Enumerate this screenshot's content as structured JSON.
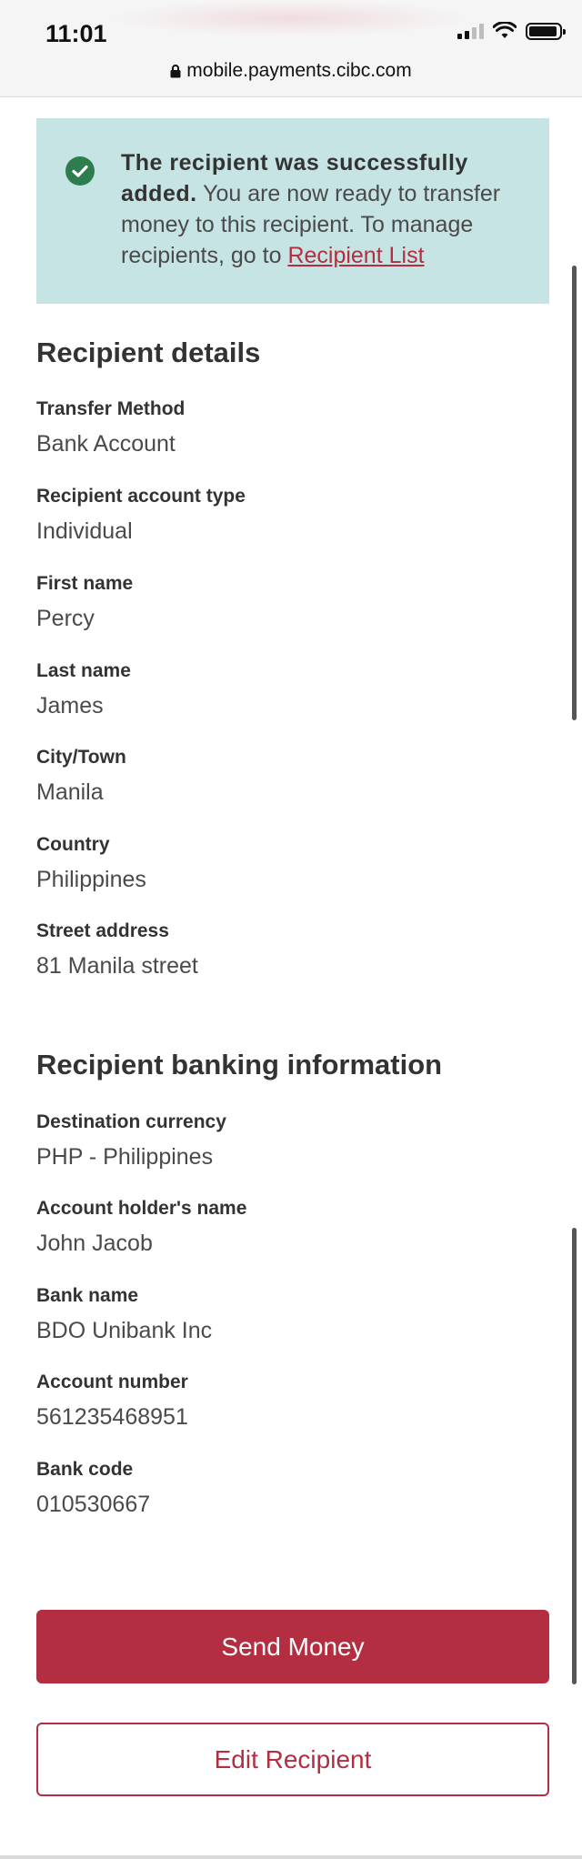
{
  "status_bar": {
    "time": "11:01"
  },
  "browser": {
    "url": "mobile.payments.cibc.com"
  },
  "banner": {
    "title": "The recipient was successfully added.",
    "message": " You are now ready to transfer money to this recipient. To manage recipients, go to ",
    "link_label": "Recipient List"
  },
  "recipient_details": {
    "title": "Recipient details",
    "fields": [
      {
        "label": "Transfer Method",
        "value": "Bank Account"
      },
      {
        "label": "Recipient account type",
        "value": "Individual"
      },
      {
        "label": "First name",
        "value": "Percy"
      },
      {
        "label": "Last name",
        "value": "James"
      },
      {
        "label": "City/Town",
        "value": "Manila"
      },
      {
        "label": "Country",
        "value": "Philippines"
      },
      {
        "label": "Street address",
        "value": "81 Manila street"
      }
    ]
  },
  "banking_info": {
    "title": "Recipient banking information",
    "fields": [
      {
        "label": "Destination currency",
        "value": "PHP - Philippines"
      },
      {
        "label": "Account holder's name",
        "value": "John Jacob"
      },
      {
        "label": "Bank name",
        "value": "BDO Unibank Inc"
      },
      {
        "label": "Account number",
        "value": "561235468951"
      },
      {
        "label": "Bank code",
        "value": "010530667"
      }
    ]
  },
  "actions": {
    "send_money_label": "Send Money",
    "edit_recipient_label": "Edit Recipient"
  },
  "colors": {
    "brand_red": "#b22e40",
    "banner_bg": "#c6e4e3",
    "success_green": "#2e7d4f"
  }
}
